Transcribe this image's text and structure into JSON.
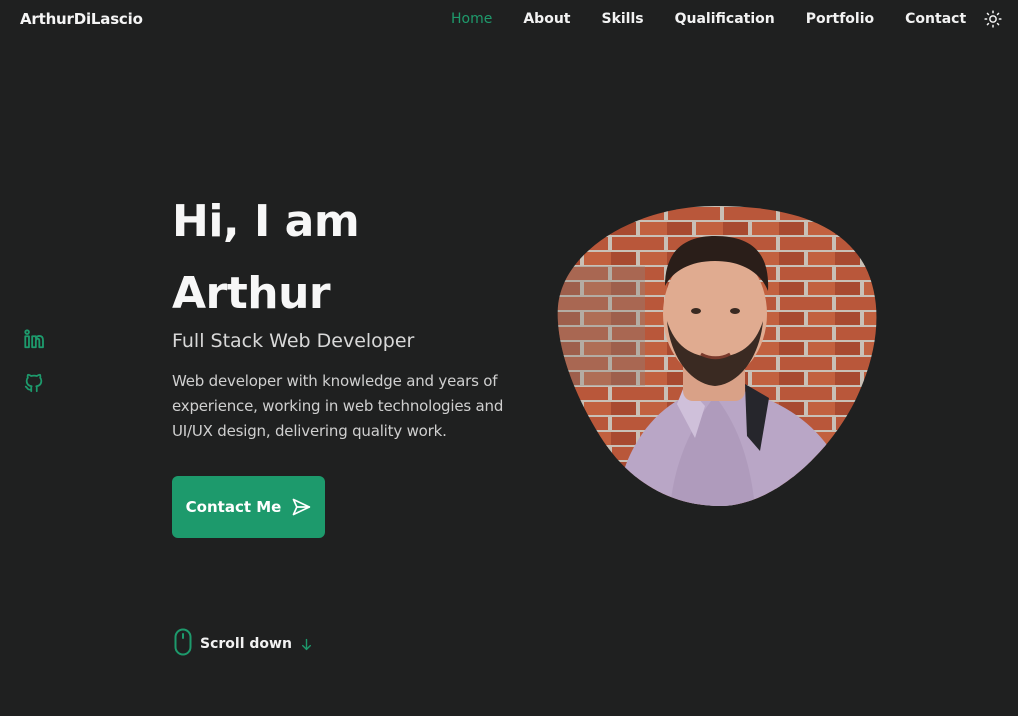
{
  "header": {
    "logo": "ArthurDiLascio",
    "nav": [
      {
        "label": "Home",
        "active": true
      },
      {
        "label": "About",
        "active": false
      },
      {
        "label": "Skills",
        "active": false
      },
      {
        "label": "Qualification",
        "active": false
      },
      {
        "label": "Portfolio",
        "active": false
      },
      {
        "label": "Contact",
        "active": false
      }
    ],
    "theme_icon": "sun-icon"
  },
  "social": [
    {
      "icon": "linkedin-icon"
    },
    {
      "icon": "github-icon"
    }
  ],
  "hero": {
    "greeting": "Hi, I am",
    "name": "Arthur",
    "subtitle": "Full Stack Web Developer",
    "description": "Web developer with knowledge and years of experience, working in web technologies and UI/UX design, delivering quality work.",
    "button_label": "Contact Me",
    "button_icon": "send-icon"
  },
  "scroll": {
    "label": "Scroll down",
    "mouse_icon": "mouse-icon",
    "arrow_icon": "arrow-down-icon"
  },
  "colors": {
    "background": "#1f2020",
    "accent": "#1d9a6c",
    "text": "#f2f2f2"
  }
}
